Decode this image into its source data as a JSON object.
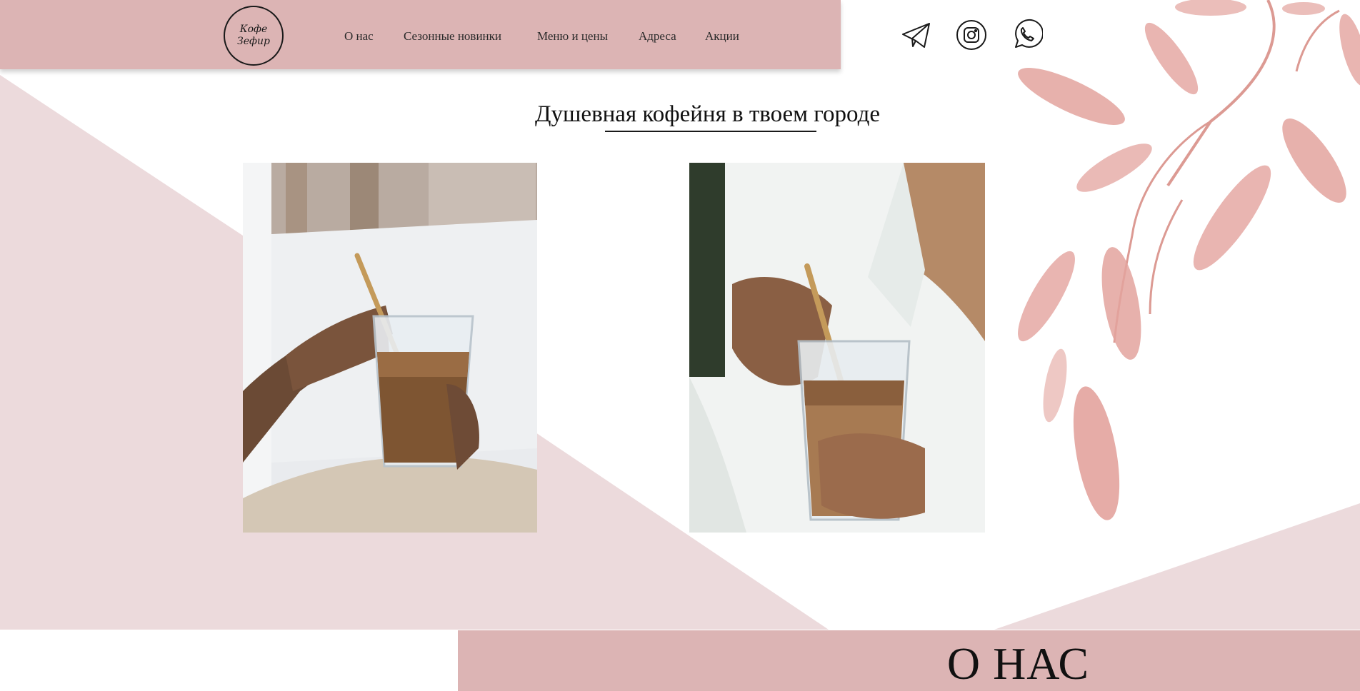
{
  "brand": {
    "logo_line1": "Кофе",
    "logo_line2": "Зефир"
  },
  "nav": [
    {
      "label": "О нас"
    },
    {
      "label": "Сезонные новинки"
    },
    {
      "label": "Меню и цены"
    },
    {
      "label": "Адреса"
    },
    {
      "label": "Акции"
    }
  ],
  "social": [
    {
      "icon": "telegram-icon"
    },
    {
      "icon": "instagram-icon"
    },
    {
      "icon": "whatsapp-icon"
    }
  ],
  "hero": {
    "title": "Душевная кофейня в твоем городе"
  },
  "about": {
    "title": "О НАС"
  },
  "colors": {
    "nav_bg": "#dcb4b4",
    "bg_shape": "#ecdadc",
    "leaf": "#e3a39d",
    "text": "#1a1a1a"
  }
}
